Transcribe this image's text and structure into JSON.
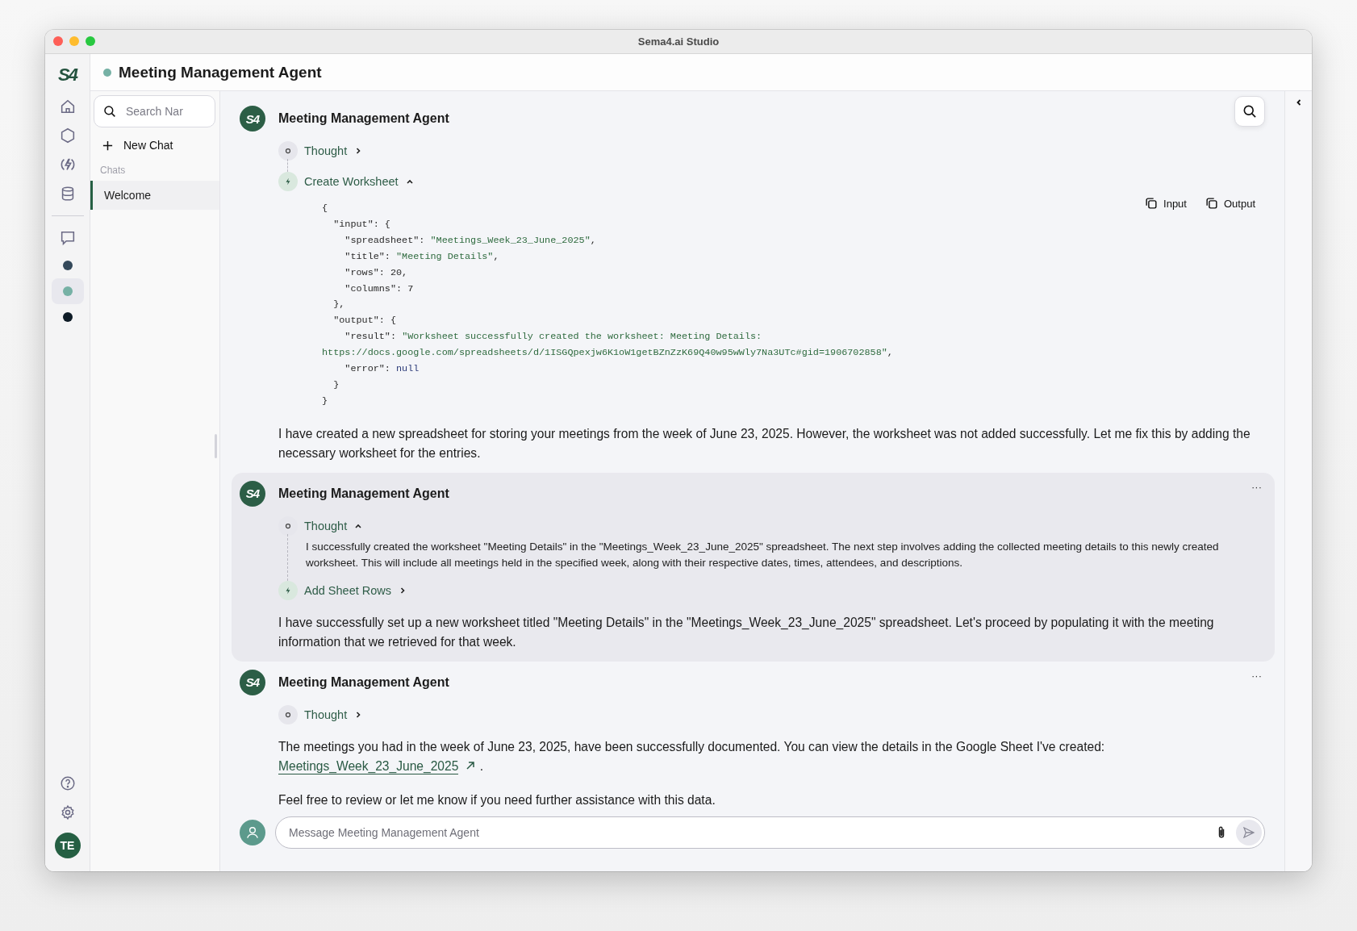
{
  "window": {
    "title": "Sema4.ai Studio"
  },
  "rail": {
    "logo": "S4",
    "agents": [
      {
        "color": "#34495a",
        "selected": false
      },
      {
        "color": "#76b1a5",
        "selected": true
      },
      {
        "color": "#0e1b26",
        "selected": false
      }
    ],
    "user_initials": "TE"
  },
  "header": {
    "title": "Meeting Management Agent"
  },
  "chat_list": {
    "search": {
      "placeholder": "Search Nar"
    },
    "new_chat": "New Chat",
    "section": "Chats",
    "items": [
      {
        "label": "Welcome",
        "selected": true
      }
    ]
  },
  "messages": [
    {
      "author": "Meeting Management Agent",
      "avatar": "S4",
      "highlighted": false,
      "steps": [
        {
          "kind": "thought",
          "label": "Thought",
          "expanded": false
        },
        {
          "kind": "tool",
          "label": "Create Worksheet",
          "expanded": true,
          "copy_buttons": [
            "Input",
            "Output"
          ],
          "code_lines": [
            [
              {
                "t": "{"
              }
            ],
            [
              {
                "t": "  \"input\": {"
              }
            ],
            [
              {
                "t": "    \"spreadsheet\": "
              },
              {
                "t": "\"Meetings_Week_23_June_2025\"",
                "kind": "string"
              },
              {
                "t": ","
              }
            ],
            [
              {
                "t": "    \"title\": "
              },
              {
                "t": "\"Meeting Details\"",
                "kind": "string"
              },
              {
                "t": ","
              }
            ],
            [
              {
                "t": "    \"rows\": 20,"
              }
            ],
            [
              {
                "t": "    \"columns\": 7"
              }
            ],
            [
              {
                "t": "  },"
              }
            ],
            [
              {
                "t": "  \"output\": {"
              }
            ],
            [
              {
                "t": "    \"result\": "
              },
              {
                "t": "\"Worksheet successfully created the worksheet: Meeting Details:",
                "kind": "string"
              }
            ],
            [
              {
                "t": "https://docs.google.com/spreadsheets/d/1ISGQpexjw6K1oW1getBZnZzK69Q40w95wWly7Na3UTc#gid=1906702858\"",
                "kind": "string"
              },
              {
                "t": ","
              }
            ],
            [
              {
                "t": "    \"error\": "
              },
              {
                "t": "null",
                "kind": "null"
              }
            ],
            [
              {
                "t": "  }"
              }
            ],
            [
              {
                "t": "}"
              }
            ]
          ]
        }
      ],
      "paragraphs": [
        {
          "text": "I have created a new spreadsheet for storing your meetings from the week of June 23, 2025. However, the worksheet was not added successfully. Let me fix this by adding the necessary worksheet for the entries."
        }
      ]
    },
    {
      "author": "Meeting Management Agent",
      "avatar": "S4",
      "highlighted": true,
      "menu": "···",
      "steps": [
        {
          "kind": "thought",
          "label": "Thought",
          "expanded": true,
          "text": "I successfully created the worksheet \"Meeting Details\" in the \"Meetings_Week_23_June_2025\" spreadsheet. The next step involves adding the collected meeting details to this newly created worksheet. This will include all meetings held in the specified week, along with their respective dates, times, attendees, and descriptions."
        },
        {
          "kind": "tool",
          "label": "Add Sheet Rows",
          "expanded": false
        }
      ],
      "paragraphs": [
        {
          "text": "I have successfully set up a new worksheet titled \"Meeting Details\" in the \"Meetings_Week_23_June_2025\" spreadsheet. Let's proceed by populating it with the meeting information that we retrieved for that week."
        }
      ]
    },
    {
      "author": "Meeting Management Agent",
      "avatar": "S4",
      "highlighted": false,
      "menu": "···",
      "steps": [
        {
          "kind": "thought",
          "label": "Thought",
          "expanded": false
        }
      ],
      "paragraphs": [
        {
          "text": "The meetings you had in the week of June 23, 2025, have been successfully documented. You can view the details in the Google Sheet I've created:",
          "link": "Meetings_Week_23_June_2025",
          "after": "."
        },
        {
          "text": "Feel free to review or let me know if you need further assistance with this data."
        }
      ]
    }
  ],
  "composer": {
    "placeholder": "Message Meeting Management Agent"
  }
}
